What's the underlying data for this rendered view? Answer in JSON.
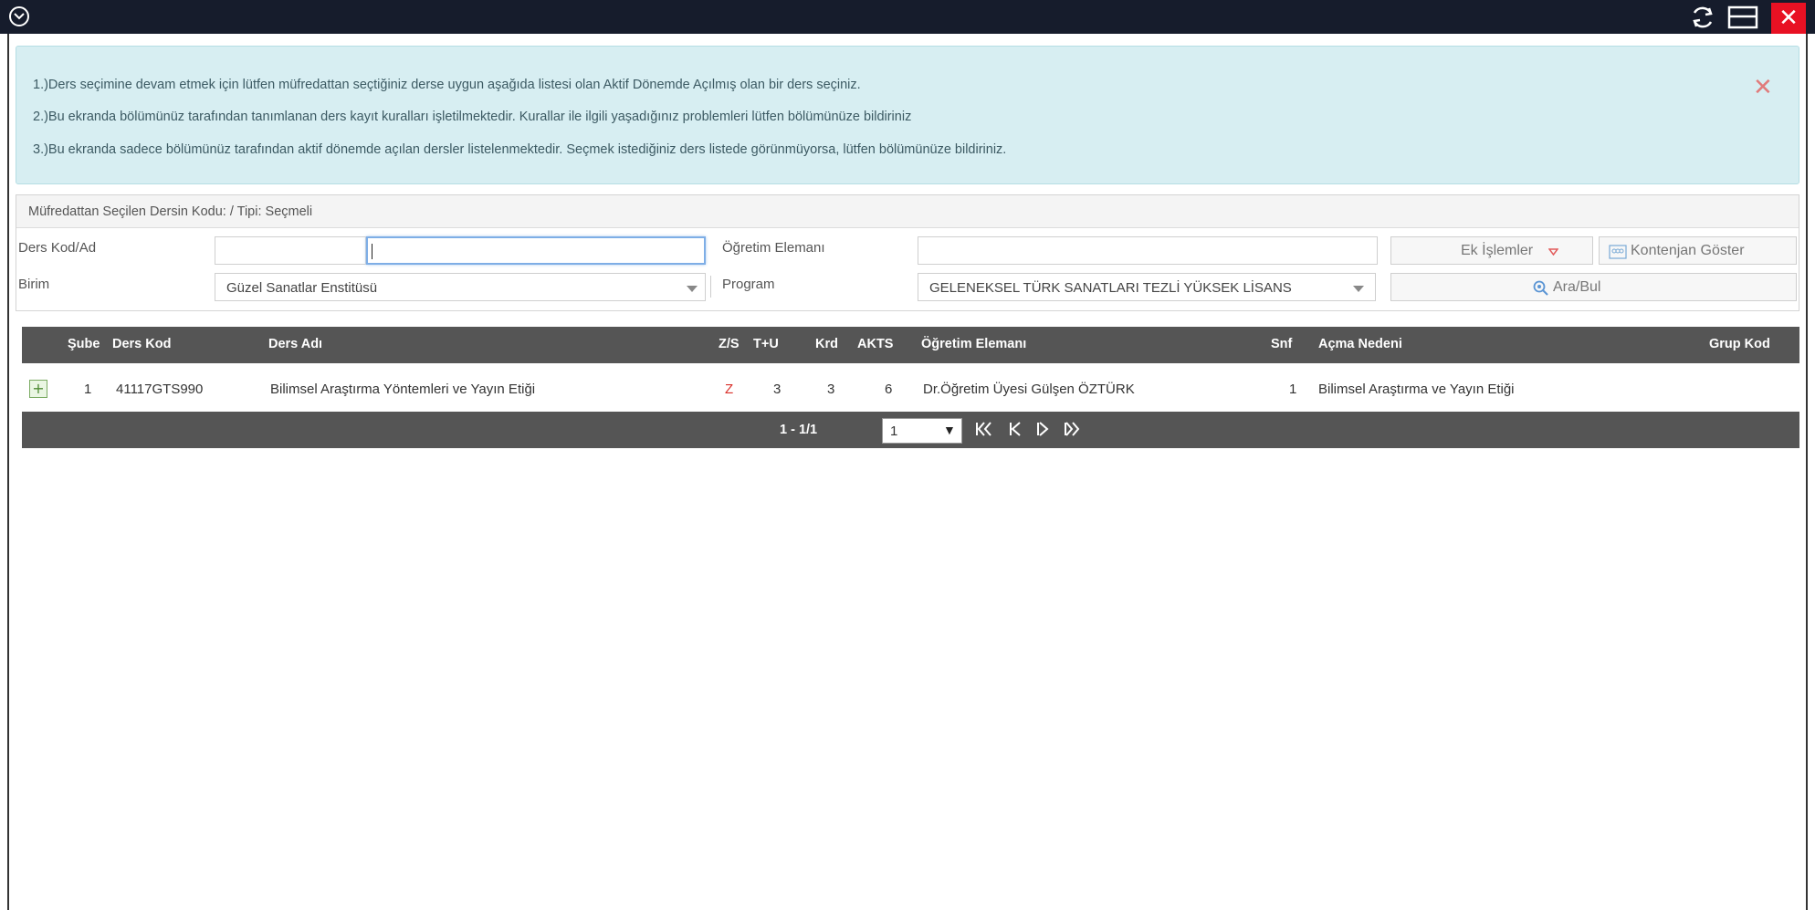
{
  "window": {
    "close_glyph": "✕"
  },
  "alert": {
    "line1": "1.)Ders seçimine devam etmek için lütfen müfredattan seçtiğiniz derse uygun aşağıda listesi olan Aktif Dönemde Açılmış olan bir ders seçiniz.",
    "line2": "2.)Bu ekranda bölümünüz tarafından tanımlanan ders kayıt kuralları işletilmektedir. Kurallar ile ilgili yaşadığınız problemleri lütfen bölümünüze bildiriniz",
    "line3": "3.)Bu ekranda sadece bölümünüz tarafından aktif dönemde açılan dersler listelenmektedir. Seçmek istediğiniz ders listede görünmüyorsa, lütfen bölümünüze bildiriniz.",
    "close_glyph": "✕"
  },
  "panel": {
    "header": "Müfredattan Seçilen Dersin Kodu: / Tipi: Seçmeli",
    "ders_kod_label": "Ders Kod/Ad",
    "ders_kod_value": "",
    "ders_ad_value": "",
    "ogretim_label": "Öğretim Elemanı",
    "ogretim_value": "",
    "birim_label": "Birim",
    "birim_value": "Güzel Sanatlar Enstitüsü",
    "program_label": "Program",
    "program_value": "GELENEKSEL TÜRK SANATLARI TEZLİ YÜKSEK LİSANS",
    "ek_islemler_label": "Ek İşlemler",
    "kontenjan_label": "Kontenjan Göster",
    "ara_label": "Ara/Bul"
  },
  "grid": {
    "headers": {
      "sube": "Şube",
      "ders_kod": "Ders Kod",
      "ders_adi": "Ders Adı",
      "zs": "Z/S",
      "tu": "T+U",
      "krd": "Krd",
      "akts": "AKTS",
      "ogretim": "Öğretim Elemanı",
      "snf": "Snf",
      "acma": "Açma Nedeni",
      "grup": "Grup Kod"
    },
    "rows": [
      {
        "sube": "1",
        "ders_kod": "41117GTS990",
        "ders_adi": "Bilimsel Araştırma Yöntemleri ve Yayın Etiği",
        "zs": "Z",
        "tu": "3",
        "krd": "3",
        "akts": "6",
        "ogretim": "Dr.Öğretim Üyesi Gülşen ÖZTÜRK",
        "snf": "1",
        "acma": "Bilimsel Araştırma ve Yayın Etiği",
        "grup": ""
      }
    ],
    "pager": {
      "info": "1 - 1/1",
      "page": "1"
    }
  },
  "colors": {
    "titlebar": "#161c2c",
    "alert_bg": "#d7eef2",
    "grid_header": "#555555",
    "close_red": "#e81123",
    "zs_red": "#d9302a"
  }
}
